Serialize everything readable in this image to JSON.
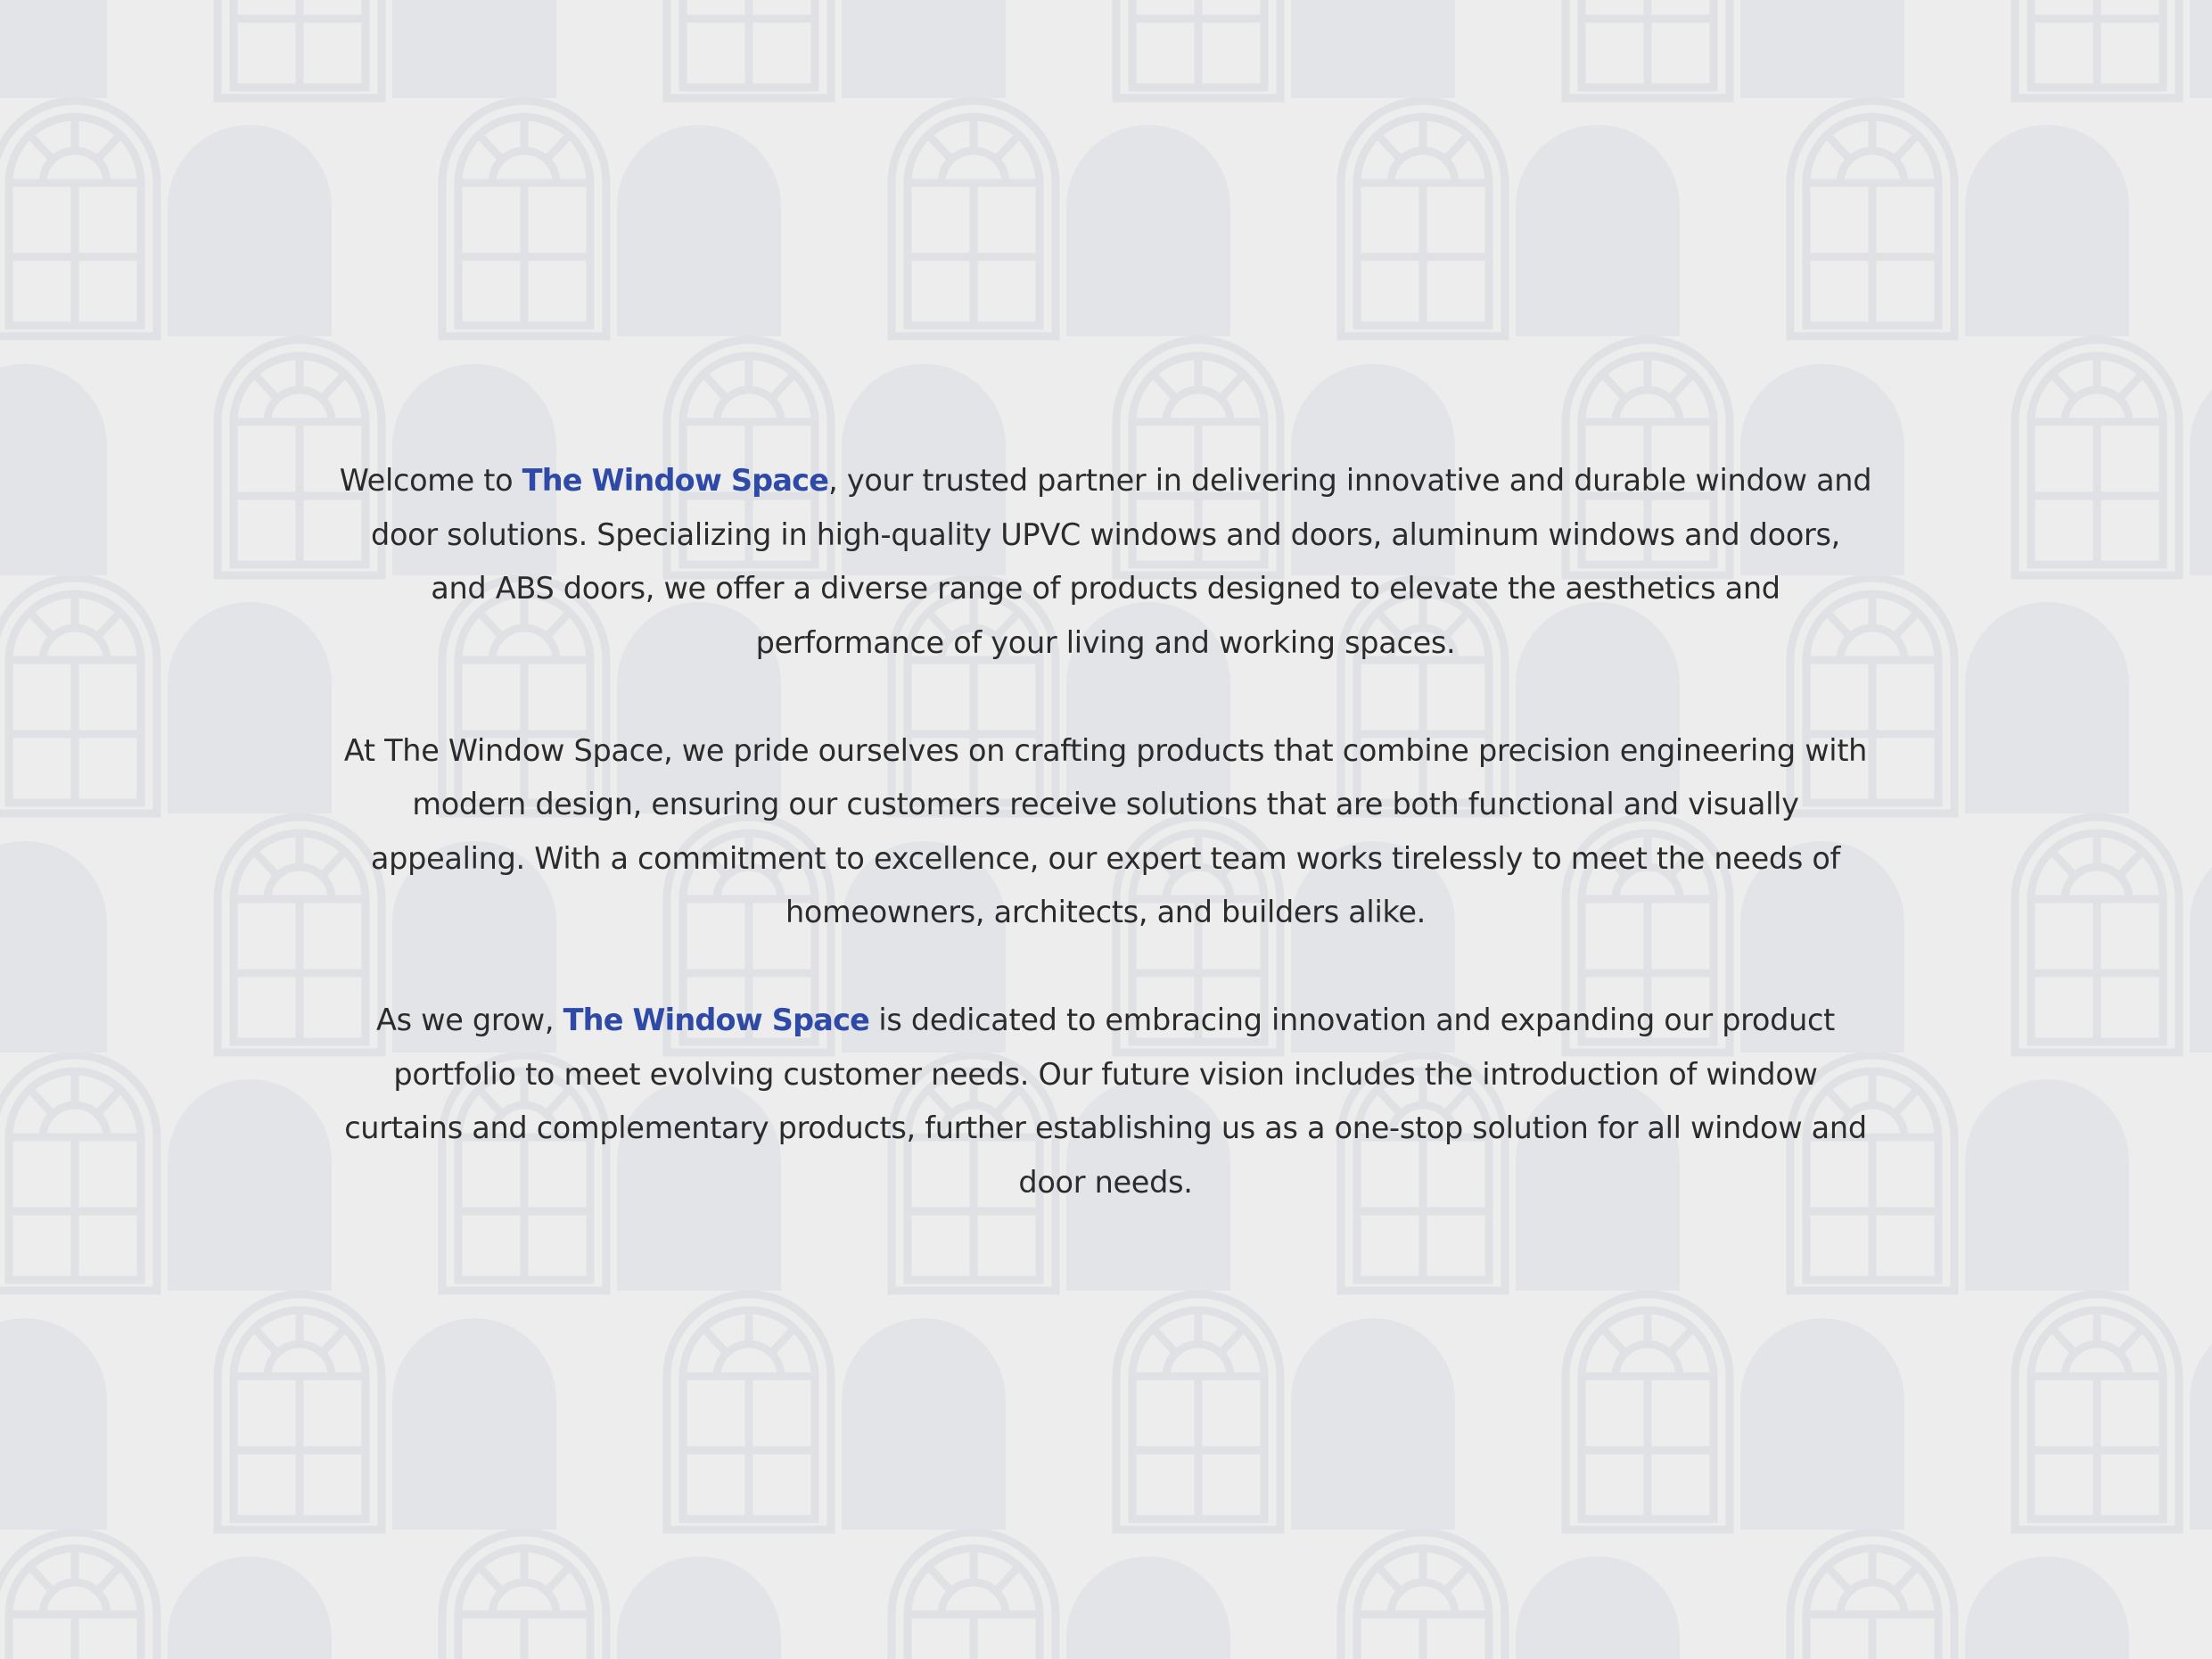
{
  "brand_color": "#2E4AA6",
  "text_color": "#2B2B2B",
  "background_color": "#ECEDEC",
  "background_pattern_icon": "arched-window-icon",
  "paragraphs": [
    {
      "pre": "Welcome to ",
      "brand": "The Window Space",
      "post": ", your trusted partner in delivering innovative and durable window and door solutions. Specializing in high-quality UPVC windows and doors, aluminum windows and doors, and ABS doors, we offer a diverse range of products designed to elevate the aesthetics and performance of your living and working spaces."
    },
    {
      "text": "At The Window Space, we pride ourselves on crafting products that combine precision engineering with modern design, ensuring our customers receive solutions that are both functional and visually appealing. With a commitment to excellence, our expert team works tirelessly to meet the needs of homeowners, architects, and builders alike."
    },
    {
      "pre": "As we grow, ",
      "brand": "The Window Space",
      "post": " is dedicated to embracing innovation and expanding our product portfolio to meet evolving customer needs. Our future vision includes the introduction of window curtains and complementary products, further establishing us as a one-stop solution for all window and door needs."
    }
  ]
}
